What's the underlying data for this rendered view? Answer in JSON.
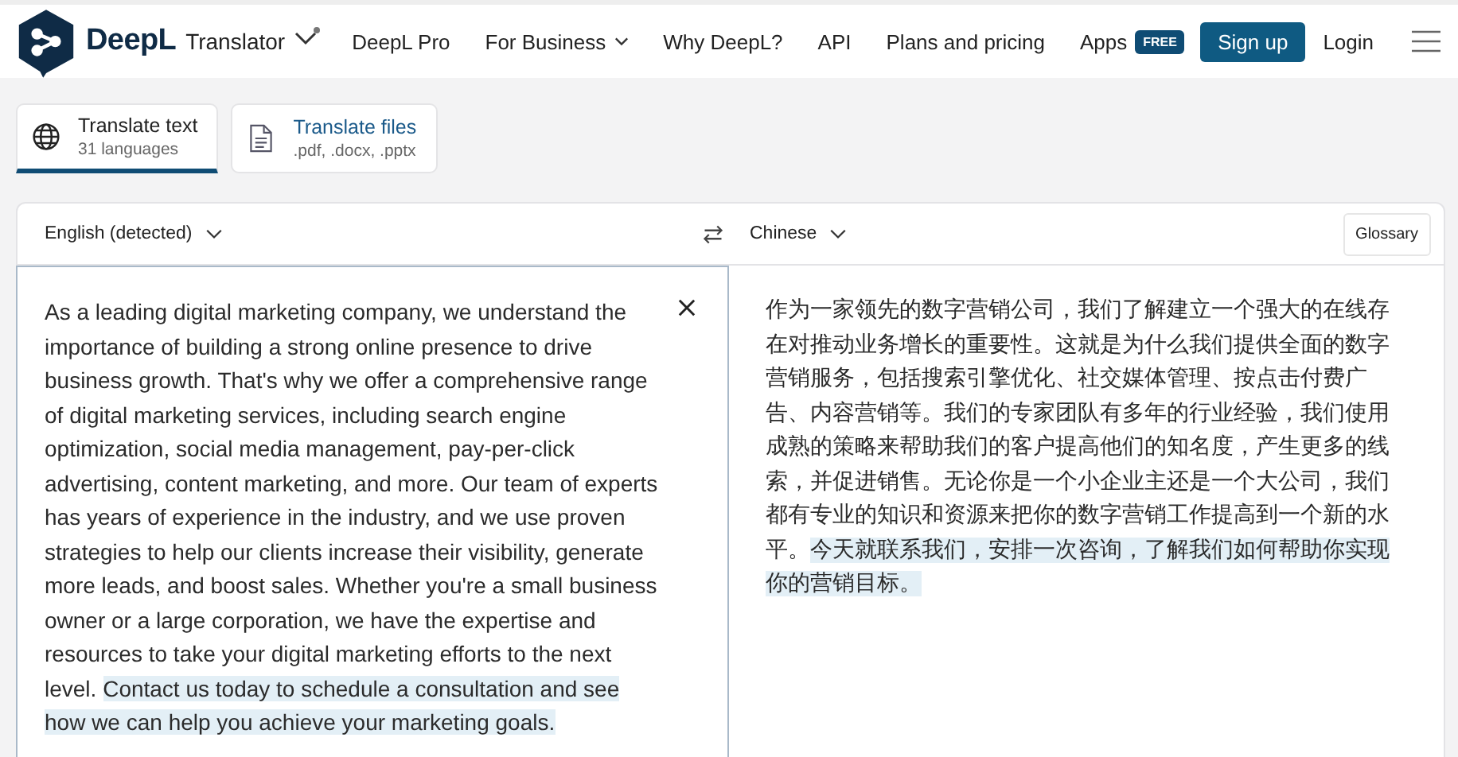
{
  "header": {
    "brand": "DeepL",
    "product": "Translator",
    "nav": [
      {
        "label": "DeepL Pro",
        "dropdown": false
      },
      {
        "label": "For Business",
        "dropdown": true
      },
      {
        "label": "Why DeepL?",
        "dropdown": false
      },
      {
        "label": "API",
        "dropdown": false
      },
      {
        "label": "Plans and pricing",
        "dropdown": false
      },
      {
        "label": "Apps",
        "dropdown": false,
        "badge": "FREE"
      }
    ],
    "signup": "Sign up",
    "login": "Login"
  },
  "modes": [
    {
      "kind": "text",
      "title": "Translate text",
      "subtitle": "31 languages",
      "selected": true
    },
    {
      "kind": "files",
      "title": "Translate files",
      "subtitle": ".pdf, .docx, .pptx",
      "selected": false
    }
  ],
  "source": {
    "language": "English (detected)",
    "segments": [
      {
        "text": "As a leading digital marketing company, we understand the importance of building a strong online presence to drive business growth. That's why we offer a comprehensive range of digital marketing services, including search engine optimization, social media management, pay-per-click advertising, content marketing, and more. Our team of experts has years of experience in the industry, and we use proven strategies to help our clients increase their visibility, generate more leads, and boost sales. Whether you're a small business owner or a large corporation, we have the expertise and resources to take your digital marketing efforts to the next level. ",
        "highlighted": false
      },
      {
        "text": "Contact us today to schedule a consultation and see how we can help you achieve your marketing goals.",
        "highlighted": true
      }
    ]
  },
  "target": {
    "language": "Chinese",
    "glossary": "Glossary",
    "segments": [
      {
        "text": "作为一家领先的数字营销公司，我们了解建立一个强大的在线存在对推动业务增长的重要性。这就是为什么我们提供全面的数字营销服务，包括搜索引擎优化、社交媒体管理、按点击付费广告、内容营销等。我们的专家团队有多年的行业经验，我们使用成熟的策略来帮助我们的客户提高他们的知名度，产生更多的线索，并促进销售。无论你是一个小企业主还是一个大公司，我们都有专业的知识和资源来把你的数字营销工作提高到一个新的水平。",
        "highlighted": false
      },
      {
        "text": "今天就联系我们，安排一次咨询，了解我们如何帮助你实现你的营销目标。",
        "highlighted": true
      }
    ]
  }
}
